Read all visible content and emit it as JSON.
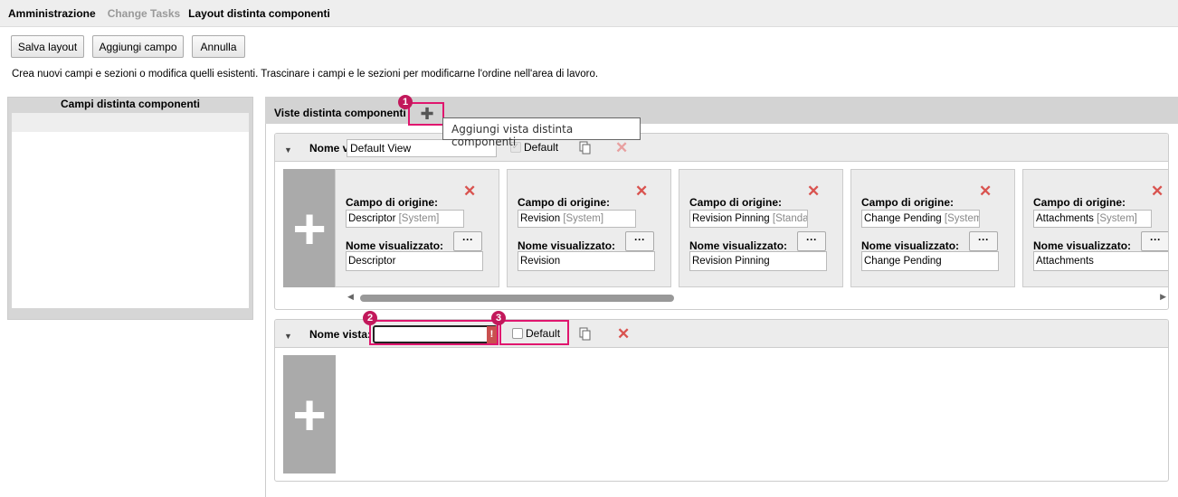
{
  "breadcrumb": {
    "items": [
      "Amministrazione",
      "Change Tasks",
      "Layout distinta componenti"
    ]
  },
  "toolbar": {
    "save": "Salva layout",
    "add_field": "Aggiungi campo",
    "cancel": "Annulla"
  },
  "description": "Crea nuovi campi e sezioni o modifica quelli esistenti. Trascinare i campi e le sezioni per modificarne l'ordine nell'area di lavoro.",
  "left_panel": {
    "title": "Campi distinta componenti"
  },
  "views_panel": {
    "title": "Viste distinta componenti",
    "tooltip": "Aggiungi vista distinta componenti"
  },
  "labels": {
    "view_name": "Nome vista:",
    "default": "Default",
    "source_field": "Campo di origine:",
    "display_name": "Nome visualizzato:",
    "dots": "···",
    "plus": "+",
    "error": "!"
  },
  "views": [
    {
      "name": "Default View",
      "default": true,
      "fields": [
        {
          "source": "Descriptor",
          "tag": "[System]",
          "display": "Descriptor"
        },
        {
          "source": "Revision",
          "tag": "[System]",
          "display": "Revision"
        },
        {
          "source": "Revision Pinning",
          "tag": "[Standar",
          "display": "Revision Pinning"
        },
        {
          "source": "Change Pending",
          "tag": "[System]",
          "display": "Change Pending"
        },
        {
          "source": "Attachments",
          "tag": "[System]",
          "display": "Attachments"
        }
      ]
    },
    {
      "name": "",
      "default": false,
      "fields": []
    }
  ],
  "callouts": [
    "1",
    "2",
    "3"
  ],
  "colors": {
    "callout": "#e0166e",
    "badge": "#c2185b"
  }
}
